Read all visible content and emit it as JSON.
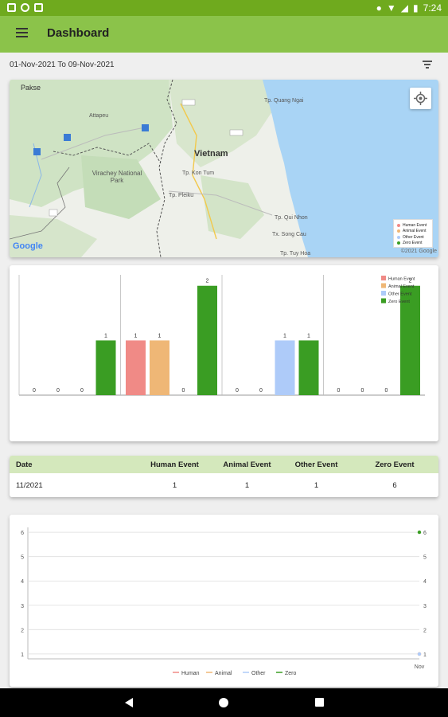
{
  "status_bar": {
    "time": "7:24"
  },
  "app_bar": {
    "title": "Dashboard"
  },
  "date_bar": {
    "range": "01-Nov-2021 To 09-Nov-2021"
  },
  "map": {
    "labels": [
      "Pakse",
      "Vietnam",
      "Virachey National Park",
      "Tp. Kon Tum",
      "Tp. Pleiku",
      "Tp. Quang Ngai",
      "Tp. Qui Nhon",
      "Tx. Song Cau",
      "Tp. Tuy Hoa",
      "Attapeu"
    ],
    "legend": [
      "Human Event",
      "Animal Event",
      "Other Event",
      "Zero Event"
    ],
    "google": "Google",
    "copyright": "©2021 Google"
  },
  "colors": {
    "human": "#f08a86",
    "animal": "#efb776",
    "other": "#aecbf9",
    "zero": "#3a9d23",
    "accent": "#8bc34a"
  },
  "chart_data": [
    {
      "type": "bar",
      "categories": [
        "",
        "",
        "",
        ""
      ],
      "series": [
        {
          "name": "Human Event",
          "values": [
            0,
            1,
            0,
            0
          ]
        },
        {
          "name": "Animal Event",
          "values": [
            0,
            1,
            0,
            0
          ]
        },
        {
          "name": "Other Event",
          "values": [
            0,
            0,
            1,
            0
          ]
        },
        {
          "name": "Zero Event",
          "values": [
            1,
            2,
            1,
            2
          ]
        }
      ],
      "ylim": [
        0,
        2.2
      ],
      "legend": "top-right"
    },
    {
      "type": "line",
      "x": [
        "Nov"
      ],
      "series": [
        {
          "name": "Human",
          "values": [
            1
          ]
        },
        {
          "name": "Animal",
          "values": [
            1
          ]
        },
        {
          "name": "Other",
          "values": [
            1
          ]
        },
        {
          "name": "Zero",
          "values": [
            6
          ]
        }
      ],
      "yticks": [
        1,
        2,
        3,
        4,
        5,
        6
      ],
      "ylim": [
        0.8,
        6.2
      ],
      "legend": "bottom-center",
      "grid": true
    }
  ],
  "table": {
    "headers": [
      "Date",
      "Human Event",
      "Animal Event",
      "Other Event",
      "Zero Event"
    ],
    "rows": [
      [
        "11/2021",
        "1",
        "1",
        "1",
        "6"
      ]
    ]
  }
}
